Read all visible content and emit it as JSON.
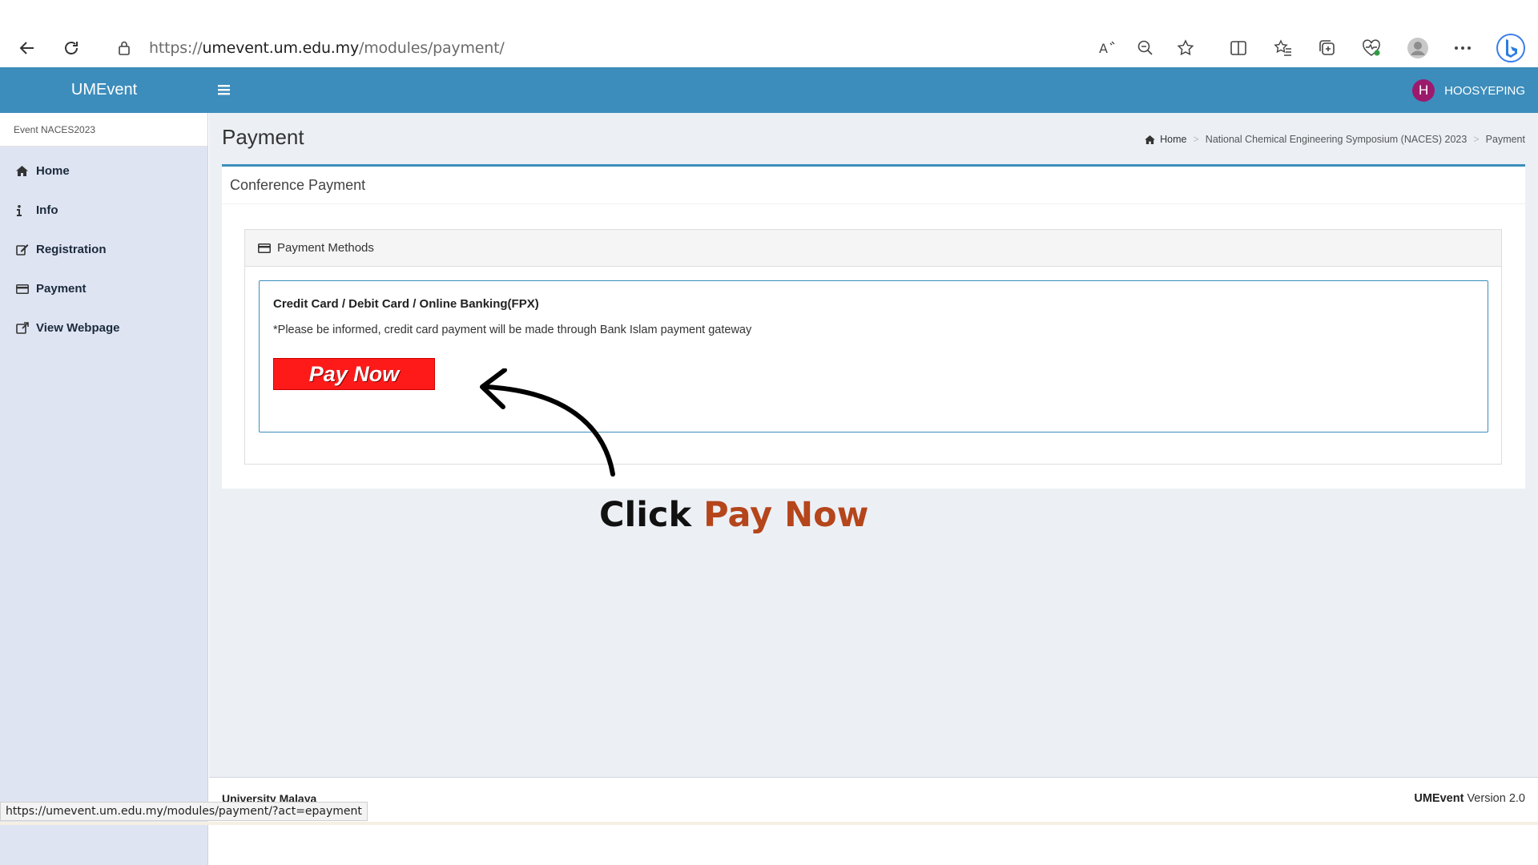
{
  "browser": {
    "url_prefix": "https://",
    "url_host": "umevent.um.edu.my",
    "url_path": "/modules/payment/",
    "icons": [
      "back-icon",
      "refresh-icon",
      "lock-icon",
      "read-aloud-icon",
      "zoom-out-icon",
      "favorite-star-icon",
      "split-screen-icon",
      "favorites-icon",
      "collections-icon",
      "browser-health-icon",
      "profile-icon",
      "more-icon",
      "bing-icon"
    ]
  },
  "header": {
    "logo": "UMEvent",
    "user_initial": "H",
    "user_name": "HOOSYEPING",
    "brand_color": "#3c8dbc"
  },
  "sidebar": {
    "event_label": "Event NACES2023",
    "items": [
      {
        "label": "Home",
        "icon": "home-icon"
      },
      {
        "label": "Info",
        "icon": "info-icon"
      },
      {
        "label": "Registration",
        "icon": "edit-icon"
      },
      {
        "label": "Payment",
        "icon": "credit-card-icon"
      },
      {
        "label": "View Webpage",
        "icon": "external-link-icon"
      }
    ]
  },
  "main": {
    "page_title": "Payment",
    "breadcrumb": [
      "Home",
      "National Chemical Engineering Symposium (NACES) 2023",
      "Payment"
    ],
    "box_title": "Conference Payment",
    "panel_title": "Payment Methods",
    "method_title": "Credit Card / Debit Card / Online Banking(FPX)",
    "method_note": "*Please be informed, credit card payment will be made through Bank Islam payment gateway",
    "pay_button": "Pay Now",
    "pay_button_color": "#ff1a1a"
  },
  "annotation": {
    "prefix": "Click",
    "highlight": "Pay Now",
    "highlight_color": "#b5451b"
  },
  "footer": {
    "left": "University Malaya",
    "brand": "UMEvent",
    "version": "Version 2.0"
  },
  "status_bar": {
    "link": "https://umevent.um.edu.my/modules/payment/?act=epayment"
  }
}
